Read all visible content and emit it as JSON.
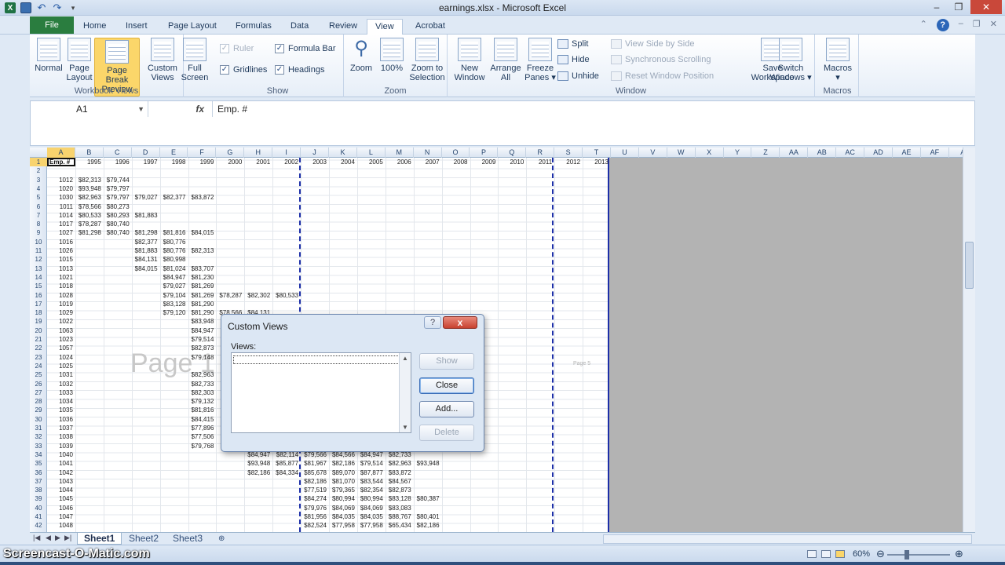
{
  "window": {
    "title": "earnings.xlsx - Microsoft Excel"
  },
  "tabs": {
    "file": "File",
    "items": [
      "Home",
      "Insert",
      "Page Layout",
      "Formulas",
      "Data",
      "Review",
      "View",
      "Acrobat"
    ],
    "active": "View"
  },
  "ribbon": {
    "workbook_views": {
      "label": "Workbook Views",
      "normal": "Normal",
      "page_layout": [
        "Page",
        "Layout"
      ],
      "page_break_preview": [
        "Page Break",
        "Preview"
      ],
      "custom_views": [
        "Custom",
        "Views"
      ],
      "full_screen": [
        "Full",
        "Screen"
      ]
    },
    "show": {
      "label": "Show",
      "ruler": "Ruler",
      "formula_bar": "Formula Bar",
      "gridlines": "Gridlines",
      "headings": "Headings"
    },
    "zoom": {
      "label": "Zoom",
      "zoom": "Zoom",
      "zoom_100": "100%",
      "zoom_to_selection": [
        "Zoom to",
        "Selection"
      ]
    },
    "window": {
      "label": "Window",
      "new_window": [
        "New",
        "Window"
      ],
      "arrange_all": [
        "Arrange",
        "All"
      ],
      "freeze_panes": [
        "Freeze",
        "Panes"
      ],
      "split": "Split",
      "hide": "Hide",
      "unhide": "Unhide",
      "view_side_by_side": "View Side by Side",
      "synchronous_scrolling": "Synchronous Scrolling",
      "reset_window_position": "Reset Window Position",
      "save_workspace": [
        "Save",
        "Workspace"
      ],
      "switch_windows": [
        "Switch",
        "Windows"
      ]
    },
    "macros": {
      "label": "Macros",
      "macros": "Macros"
    }
  },
  "formula_bar": {
    "name_box": "A1",
    "fx": "fx",
    "content": "Emp. #"
  },
  "grid": {
    "columns": [
      "A",
      "B",
      "C",
      "D",
      "E",
      "F",
      "G",
      "H",
      "I",
      "J",
      "K",
      "L",
      "M",
      "N",
      "O",
      "P",
      "Q",
      "R",
      "S",
      "T",
      "U",
      "V",
      "W",
      "X",
      "Y",
      "Z",
      "AA",
      "AB",
      "AC",
      "AD",
      "AE",
      "AF",
      "A"
    ],
    "header_row": [
      "1995",
      "1996",
      "1997",
      "1998",
      "1999",
      "2000",
      "2001",
      "2002",
      "2003",
      "2004",
      "2005",
      "2006",
      "2007",
      "2008",
      "2009",
      "2010",
      "2011",
      "2012",
      "2013"
    ],
    "a1_value": "Emp. #",
    "watermark": "Page 1",
    "page5_label": "Page 5",
    "rows": [
      {
        "r": "3",
        "emp": "1012",
        "vals": [
          "$82,313",
          "$79,744"
        ],
        "start": 1
      },
      {
        "r": "4",
        "emp": "1020",
        "vals": [
          "$93,948",
          "$79,797"
        ],
        "start": 1
      },
      {
        "r": "5",
        "emp": "1030",
        "vals": [
          "$82,963",
          "$79,797",
          "$79,027",
          "$82,377",
          "$83,872"
        ],
        "start": 1
      },
      {
        "r": "6",
        "emp": "1011",
        "vals": [
          "$78,566",
          "$80,273"
        ],
        "start": 1
      },
      {
        "r": "7",
        "emp": "1014",
        "vals": [
          "$80,533",
          "$80,293",
          "$81,883"
        ],
        "start": 1
      },
      {
        "r": "8",
        "emp": "1017",
        "vals": [
          "$78,287",
          "$80,740"
        ],
        "start": 1
      },
      {
        "r": "9",
        "emp": "1027",
        "vals": [
          "$81,298",
          "$80,740",
          "$81,298",
          "$81,816",
          "$84,015"
        ],
        "start": 1
      },
      {
        "r": "10",
        "emp": "1016",
        "vals": [
          "$82,377",
          "$80,776"
        ],
        "start": 3
      },
      {
        "r": "11",
        "emp": "1026",
        "vals": [
          "$81,883",
          "$80,776",
          "$82,313"
        ],
        "start": 3
      },
      {
        "r": "12",
        "emp": "1015",
        "vals": [
          "$84,131",
          "$80,998"
        ],
        "start": 3
      },
      {
        "r": "13",
        "emp": "1013",
        "vals": [
          "$84,015",
          "$81,024",
          "$83,707"
        ],
        "start": 3
      },
      {
        "r": "14",
        "emp": "1021",
        "vals": [
          "$84,947",
          "$81,230"
        ],
        "start": 4
      },
      {
        "r": "15",
        "emp": "1018",
        "vals": [
          "$79,027",
          "$81,269"
        ],
        "start": 4
      },
      {
        "r": "16",
        "emp": "1028",
        "vals": [
          "$79,104",
          "$81,269",
          "$78,287",
          "$82,302",
          "$80,533"
        ],
        "start": 4
      },
      {
        "r": "17",
        "emp": "1019",
        "vals": [
          "$83,128",
          "$81,290"
        ],
        "start": 4
      },
      {
        "r": "18",
        "emp": "1029",
        "vals": [
          "$79,120",
          "$81,290",
          "$78,566",
          "$84,131"
        ],
        "start": 4
      },
      {
        "r": "19",
        "emp": "1022",
        "vals": [
          "$83,948"
        ],
        "start": 5
      },
      {
        "r": "20",
        "emp": "1063",
        "vals": [
          "$84,947"
        ],
        "start": 5
      },
      {
        "r": "21",
        "emp": "1023",
        "vals": [
          "$79,514"
        ],
        "start": 5
      },
      {
        "r": "22",
        "emp": "1057",
        "vals": [
          "$82,873"
        ],
        "start": 5
      },
      {
        "r": "23",
        "emp": "1024",
        "vals": [
          "$79,148"
        ],
        "start": 5
      },
      {
        "r": "24",
        "emp": "1025",
        "vals": [],
        "start": 5
      },
      {
        "r": "25",
        "emp": "1031",
        "vals": [
          "$82,963"
        ],
        "start": 5
      },
      {
        "r": "26",
        "emp": "1032",
        "vals": [
          "$82,733"
        ],
        "start": 5
      },
      {
        "r": "27",
        "emp": "1033",
        "vals": [
          "$82,303"
        ],
        "start": 5
      },
      {
        "r": "28",
        "emp": "1034",
        "vals": [
          "$79,132"
        ],
        "start": 5
      },
      {
        "r": "29",
        "emp": "1035",
        "vals": [
          "$81,816"
        ],
        "start": 5
      },
      {
        "r": "30",
        "emp": "1036",
        "vals": [
          "$84,415"
        ],
        "start": 5
      },
      {
        "r": "31",
        "emp": "1037",
        "vals": [
          "$77,896"
        ],
        "start": 5
      },
      {
        "r": "32",
        "emp": "1038",
        "vals": [
          "$77,506"
        ],
        "start": 5
      },
      {
        "r": "33",
        "emp": "1039",
        "vals": [
          "$79,768"
        ],
        "start": 5
      },
      {
        "r": "34",
        "emp": "1040",
        "vals": [
          "$84,947",
          "$82,114",
          "$79,566",
          "$84,566",
          "$84,947",
          "$82,733"
        ],
        "start": 7
      },
      {
        "r": "35",
        "emp": "1041",
        "vals": [
          "$93,948",
          "$85,877",
          "$81,967",
          "$82,186",
          "$79,514",
          "$82,963",
          "$93,948"
        ],
        "start": 7
      },
      {
        "r": "36",
        "emp": "1042",
        "vals": [
          "$82,186",
          "$84,334",
          "$85,678",
          "$89,070",
          "$87,877",
          "$83,872"
        ],
        "start": 7
      },
      {
        "r": "37",
        "emp": "1043",
        "vals": [
          "$82,186",
          "$81,070",
          "$83,544",
          "$84,567"
        ],
        "start": 9
      },
      {
        "r": "38",
        "emp": "1044",
        "vals": [
          "$77,519",
          "$79,365",
          "$82,354",
          "$82,873"
        ],
        "start": 9
      },
      {
        "r": "39",
        "emp": "1045",
        "vals": [
          "$84,274",
          "$80,994",
          "$80,994",
          "$83,128",
          "$80,387"
        ],
        "start": 9
      },
      {
        "r": "40",
        "emp": "1046",
        "vals": [
          "$79,976",
          "$84,069",
          "$84,069",
          "$83,083"
        ],
        "start": 9
      },
      {
        "r": "41",
        "emp": "1047",
        "vals": [
          "$81,956",
          "$84,035",
          "$84,035",
          "$88,767",
          "$80,401"
        ],
        "start": 9
      },
      {
        "r": "42",
        "emp": "1048",
        "vals": [
          "$82,524",
          "$77,958",
          "$77,958",
          "$65,434",
          "$82,186"
        ],
        "start": 9
      }
    ]
  },
  "sheets": [
    "Sheet1",
    "Sheet2",
    "Sheet3"
  ],
  "active_sheet": "Sheet1",
  "status": {
    "brand": "Screencast-O-Matic.com",
    "zoom": "60%"
  },
  "dialog": {
    "title": "Custom Views",
    "help": "?",
    "close_x": "x",
    "views_label": "Views:",
    "buttons": {
      "show": "Show",
      "close": "Close",
      "add": "Add...",
      "delete": "Delete"
    }
  }
}
